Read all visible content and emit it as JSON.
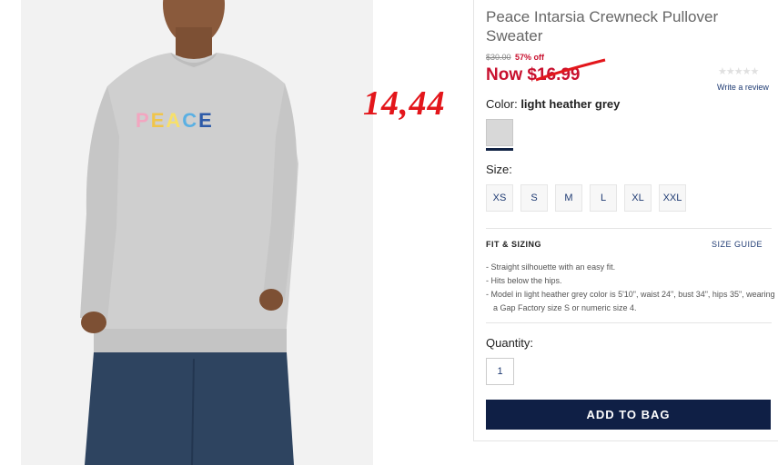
{
  "annotation": {
    "price_text": "14,44"
  },
  "product": {
    "title": "Peace Intarsia Crewneck Pullover Sweater",
    "original_price": "$30.00",
    "discount": "57% off",
    "now_price": "Now $16.99",
    "rating_stars": "★★★★★",
    "write_review": "Write a review",
    "graphic_text": "PEACE"
  },
  "color": {
    "label": "Color:",
    "value": "light heather grey",
    "swatch_hex": "#d8d8d8",
    "selected_indicator_hex": "#122344"
  },
  "size": {
    "label": "Size:",
    "options": [
      "XS",
      "S",
      "M",
      "L",
      "XL",
      "XXL"
    ]
  },
  "fit": {
    "title": "FIT & SIZING",
    "size_guide": "SIZE GUIDE",
    "bullets": [
      "- Straight silhouette with an easy fit.",
      "- Hits below the hips.",
      "- Model in light heather grey color is 5'10\", waist 24\", bust 34\", hips 35\", wearing a Gap Factory size S or numeric size 4."
    ]
  },
  "quantity": {
    "label": "Quantity:",
    "value": "1"
  },
  "cart": {
    "add_label": "ADD TO BAG",
    "button_hex": "#0f1f45"
  },
  "colors": {
    "sale_red": "#c8102e",
    "link_navy": "#1f3b73",
    "annotation_red": "#e3161b"
  }
}
